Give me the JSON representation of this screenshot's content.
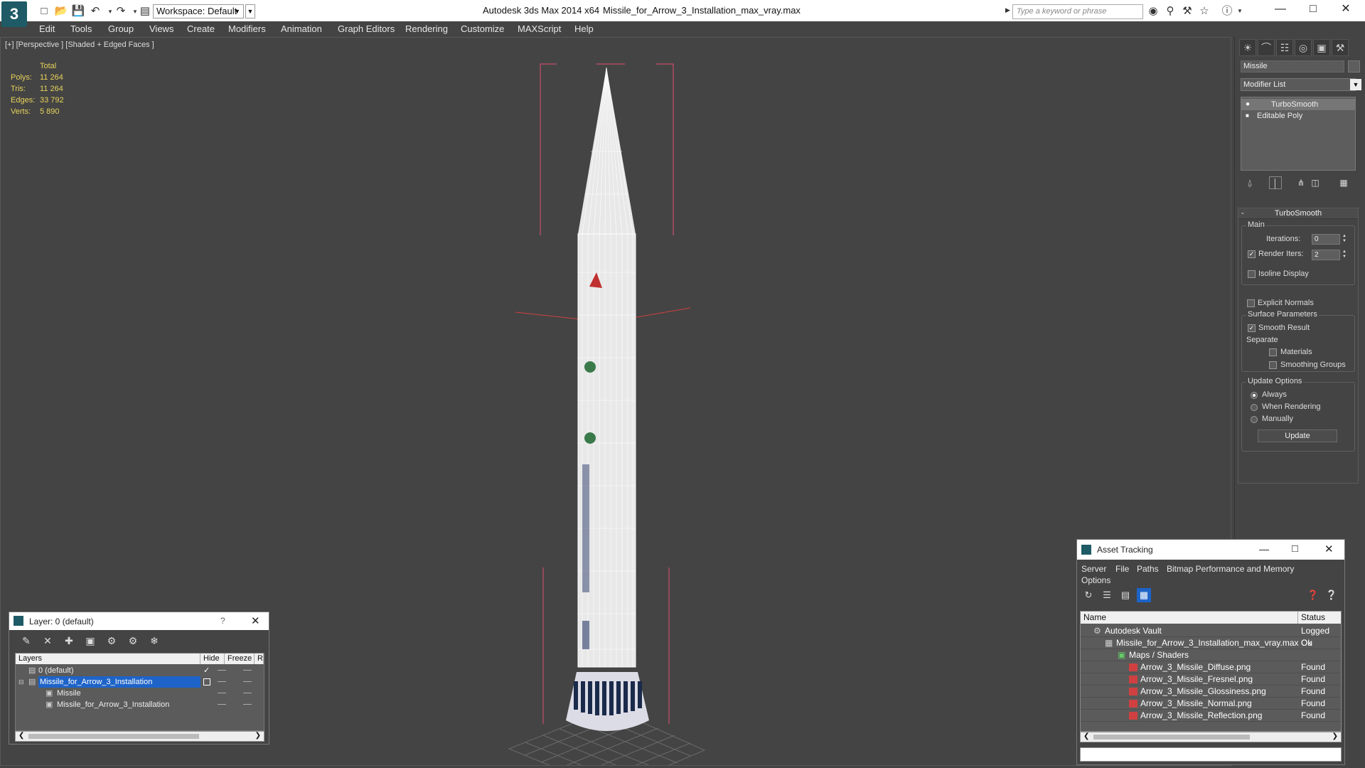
{
  "app": {
    "title": "Autodesk 3ds Max  2014 x64",
    "file": "Missile_for_Arrow_3_Installation_max_vray.max",
    "workspace": "Workspace: Default",
    "search_placeholder": "Type a keyword or phrase"
  },
  "menu": [
    "Edit",
    "Tools",
    "Group",
    "Views",
    "Create",
    "Modifiers",
    "Animation",
    "Graph Editors",
    "Rendering",
    "Customize",
    "MAXScript",
    "Help"
  ],
  "viewport": {
    "label": "[+] [Perspective ] [Shaded + Edged Faces ]",
    "stats_header": "Total",
    "stats": [
      {
        "label": "Polys:",
        "value": "11 264"
      },
      {
        "label": "Tris:",
        "value": "11 264"
      },
      {
        "label": "Edges:",
        "value": "33 792"
      },
      {
        "label": "Verts:",
        "value": "5 890"
      }
    ]
  },
  "command_panel": {
    "object_name": "Missile",
    "modifier_list": "Modifier List",
    "stack": [
      "TurboSmooth",
      "Editable Poly"
    ],
    "rollout_title": "TurboSmooth",
    "main_group": "Main",
    "iterations_label": "Iterations:",
    "iterations_value": "0",
    "render_iters_label": "Render Iters:",
    "render_iters_value": "2",
    "render_iters_checked": true,
    "isoline_label": "Isoline Display",
    "explicit_normals_label": "Explicit Normals",
    "surface_group": "Surface Parameters",
    "smooth_result_label": "Smooth Result",
    "separate_label": "Separate",
    "materials_label": "Materials",
    "smoothing_groups_label": "Smoothing Groups",
    "update_group": "Update Options",
    "update_options": [
      "Always",
      "When Rendering",
      "Manually"
    ],
    "update_selected": "Always",
    "update_button": "Update"
  },
  "layer_dialog": {
    "title": "Layer: 0 (default)",
    "help": "?",
    "columns": [
      "Layers",
      "Hide",
      "Freeze",
      "R"
    ],
    "rows": [
      {
        "name": "0 (default)",
        "indent": 0,
        "selected": false
      },
      {
        "name": "Missile_for_Arrow_3_Installation",
        "indent": 0,
        "selected": true
      },
      {
        "name": "Missile",
        "indent": 1,
        "selected": false
      },
      {
        "name": "Missile_for_Arrow_3_Installation",
        "indent": 1,
        "selected": false
      }
    ]
  },
  "asset_tracking": {
    "title": "Asset Tracking",
    "menu": [
      "Server",
      "File",
      "Paths",
      "Bitmap Performance and Memory",
      "Options"
    ],
    "columns": [
      "Name",
      "Status"
    ],
    "rows": [
      {
        "name": "Autodesk Vault",
        "status": "Logged Ou",
        "level": 0
      },
      {
        "name": "Missile_for_Arrow_3_Installation_max_vray.max",
        "status": "Ok",
        "level": 1
      },
      {
        "name": "Maps / Shaders",
        "status": "",
        "level": 2
      },
      {
        "name": "Arrow_3_Missile_Diffuse.png",
        "status": "Found",
        "level": 3
      },
      {
        "name": "Arrow_3_Missile_Fresnel.png",
        "status": "Found",
        "level": 3
      },
      {
        "name": "Arrow_3_Missile_Glossiness.png",
        "status": "Found",
        "level": 3
      },
      {
        "name": "Arrow_3_Missile_Normal.png",
        "status": "Found",
        "level": 3
      },
      {
        "name": "Arrow_3_Missile_Reflection.png",
        "status": "Found",
        "level": 3
      }
    ]
  },
  "colors": {
    "viewport_bg": "#444444",
    "stats_text": "#e8d25a",
    "selection": "#1e64c8",
    "bbox": "#e05070",
    "wire": "#ffffff"
  }
}
